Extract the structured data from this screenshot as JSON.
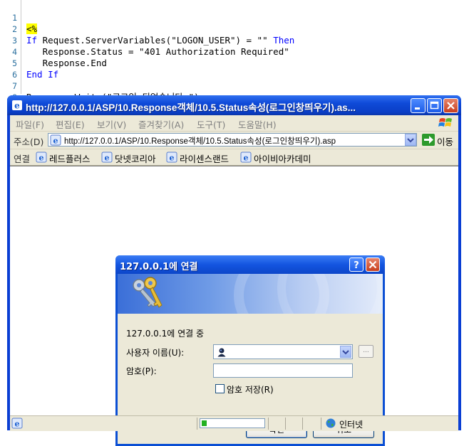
{
  "code": {
    "lines": [
      {
        "num": "1",
        "text": "<%"
      },
      {
        "num": "2",
        "kw1": "If",
        "text": " Request.ServerVariables(\"LOGON_USER\") = \"\" ",
        "kw2": "Then"
      },
      {
        "num": "3",
        "text": "   Response.Status = \"401 Authorization Required\""
      },
      {
        "num": "4",
        "text": "   Response.End"
      },
      {
        "num": "5",
        "kw1": "End If",
        "text": ""
      },
      {
        "num": "6",
        "text": ""
      },
      {
        "num": "7",
        "text": "Response.Write(\"로그인 되었습니다.\")"
      },
      {
        "num": "8",
        "text": "%>"
      }
    ]
  },
  "browser": {
    "title": "http://127.0.0.1/ASP/10.Response객체/10.5.Status속성(로그인창띄우기).as...",
    "menu": [
      "파일(F)",
      "편집(E)",
      "보기(V)",
      "즐겨찾기(A)",
      "도구(T)",
      "도움말(H)"
    ],
    "address_label": "주소(D)",
    "address_url": "http://127.0.0.1/ASP/10.Response객체/10.5.Status속성(로그인창띄우기).asp",
    "go_label": "이동",
    "links_label": "연결",
    "links": [
      "레드플러스",
      "닷넷코리아",
      "라이센스랜드",
      "아이비아카데미"
    ],
    "status": {
      "progress": 0.08,
      "zone": "인터넷"
    }
  },
  "dialog": {
    "title": "127.0.0.1에 연결",
    "message": "127.0.0.1에 연결 중",
    "user_label": "사용자 이름(U):",
    "user_value": "",
    "browse_label": "...",
    "password_label": "암호(P):",
    "password_value": "",
    "remember_label": "암호 저장(R)",
    "remember_checked": false,
    "ok_label": "확인",
    "cancel_label": "취소"
  },
  "colors": {
    "keyword": "#0000ff",
    "asp_tag_highlight": "#ffff00",
    "xp_blue": "#0a3ed3",
    "progress_green": "#21b021"
  }
}
